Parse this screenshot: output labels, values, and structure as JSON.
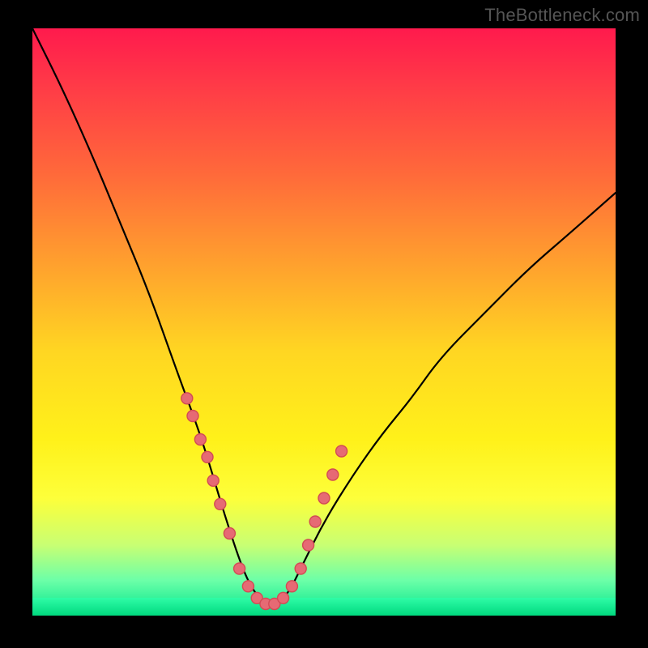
{
  "watermark": "TheBottleneck.com",
  "chart_data": {
    "type": "line",
    "title": "",
    "xlabel": "",
    "ylabel": "",
    "xlim": [
      0,
      100
    ],
    "ylim": [
      0,
      100
    ],
    "note": "V-shaped bottleneck curve; y≈bottleneck %, minimum ≈0% around x≈36–44",
    "series": [
      {
        "name": "bottleneck-curve",
        "x": [
          0,
          5,
          10,
          15,
          20,
          25,
          28,
          30,
          33,
          36,
          38,
          40,
          42,
          44,
          46,
          50,
          55,
          60,
          65,
          70,
          78,
          85,
          92,
          100
        ],
        "y": [
          100,
          90,
          79,
          67,
          55,
          41,
          33,
          27,
          17,
          8,
          4,
          2,
          2,
          4,
          8,
          16,
          24,
          31,
          37,
          44,
          52,
          59,
          65,
          72
        ]
      }
    ],
    "points": {
      "name": "highlighted-points",
      "x": [
        26.5,
        27.5,
        28.8,
        30.0,
        31.0,
        32.2,
        33.8,
        35.5,
        37.0,
        38.5,
        40.0,
        41.5,
        43.0,
        44.5,
        46.0,
        47.3,
        48.5,
        50.0,
        51.5,
        53.0
      ],
      "y": [
        37,
        34,
        30,
        27,
        23,
        19,
        14,
        8,
        5,
        3,
        2,
        2,
        3,
        5,
        8,
        12,
        16,
        20,
        24,
        28
      ]
    }
  }
}
